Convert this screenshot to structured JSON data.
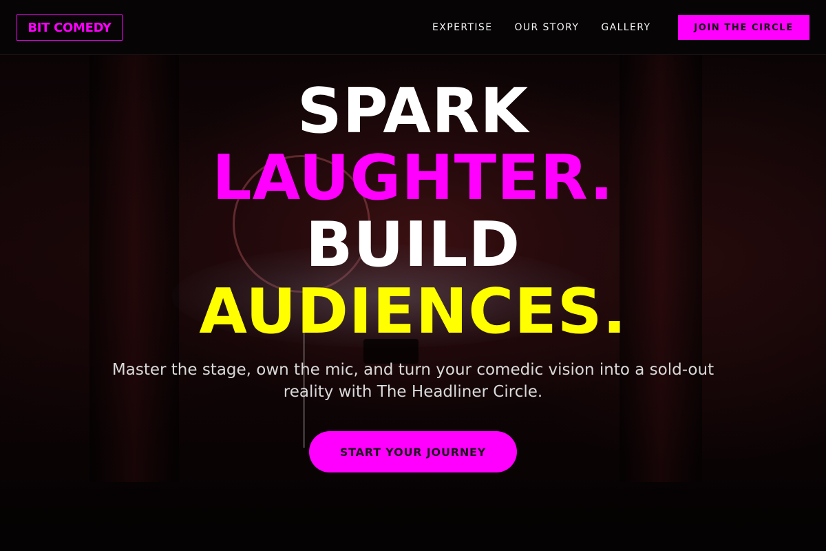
{
  "header": {
    "logo": "BIT COMEDY",
    "nav": [
      {
        "label": "EXPERTISE"
      },
      {
        "label": "OUR STORY"
      },
      {
        "label": "GALLERY"
      }
    ],
    "cta_label": "JOIN THE CIRCLE"
  },
  "hero": {
    "headline": {
      "line1": "SPARK",
      "line2": "LAUGHTER.",
      "line3": "BUILD",
      "line4": "AUDIENCES."
    },
    "subheading": "Master the stage, own the mic, and turn your comedic vision into a sold-out reality with The Headliner Circle.",
    "button_label": "START YOUR JOURNEY",
    "background_image": "dark comedy club stage with red neon sign and microphone stand"
  },
  "colors": {
    "accent": "#ff00ff",
    "highlight": "#ffff00",
    "background": "#050203",
    "text": "#ffffff"
  }
}
